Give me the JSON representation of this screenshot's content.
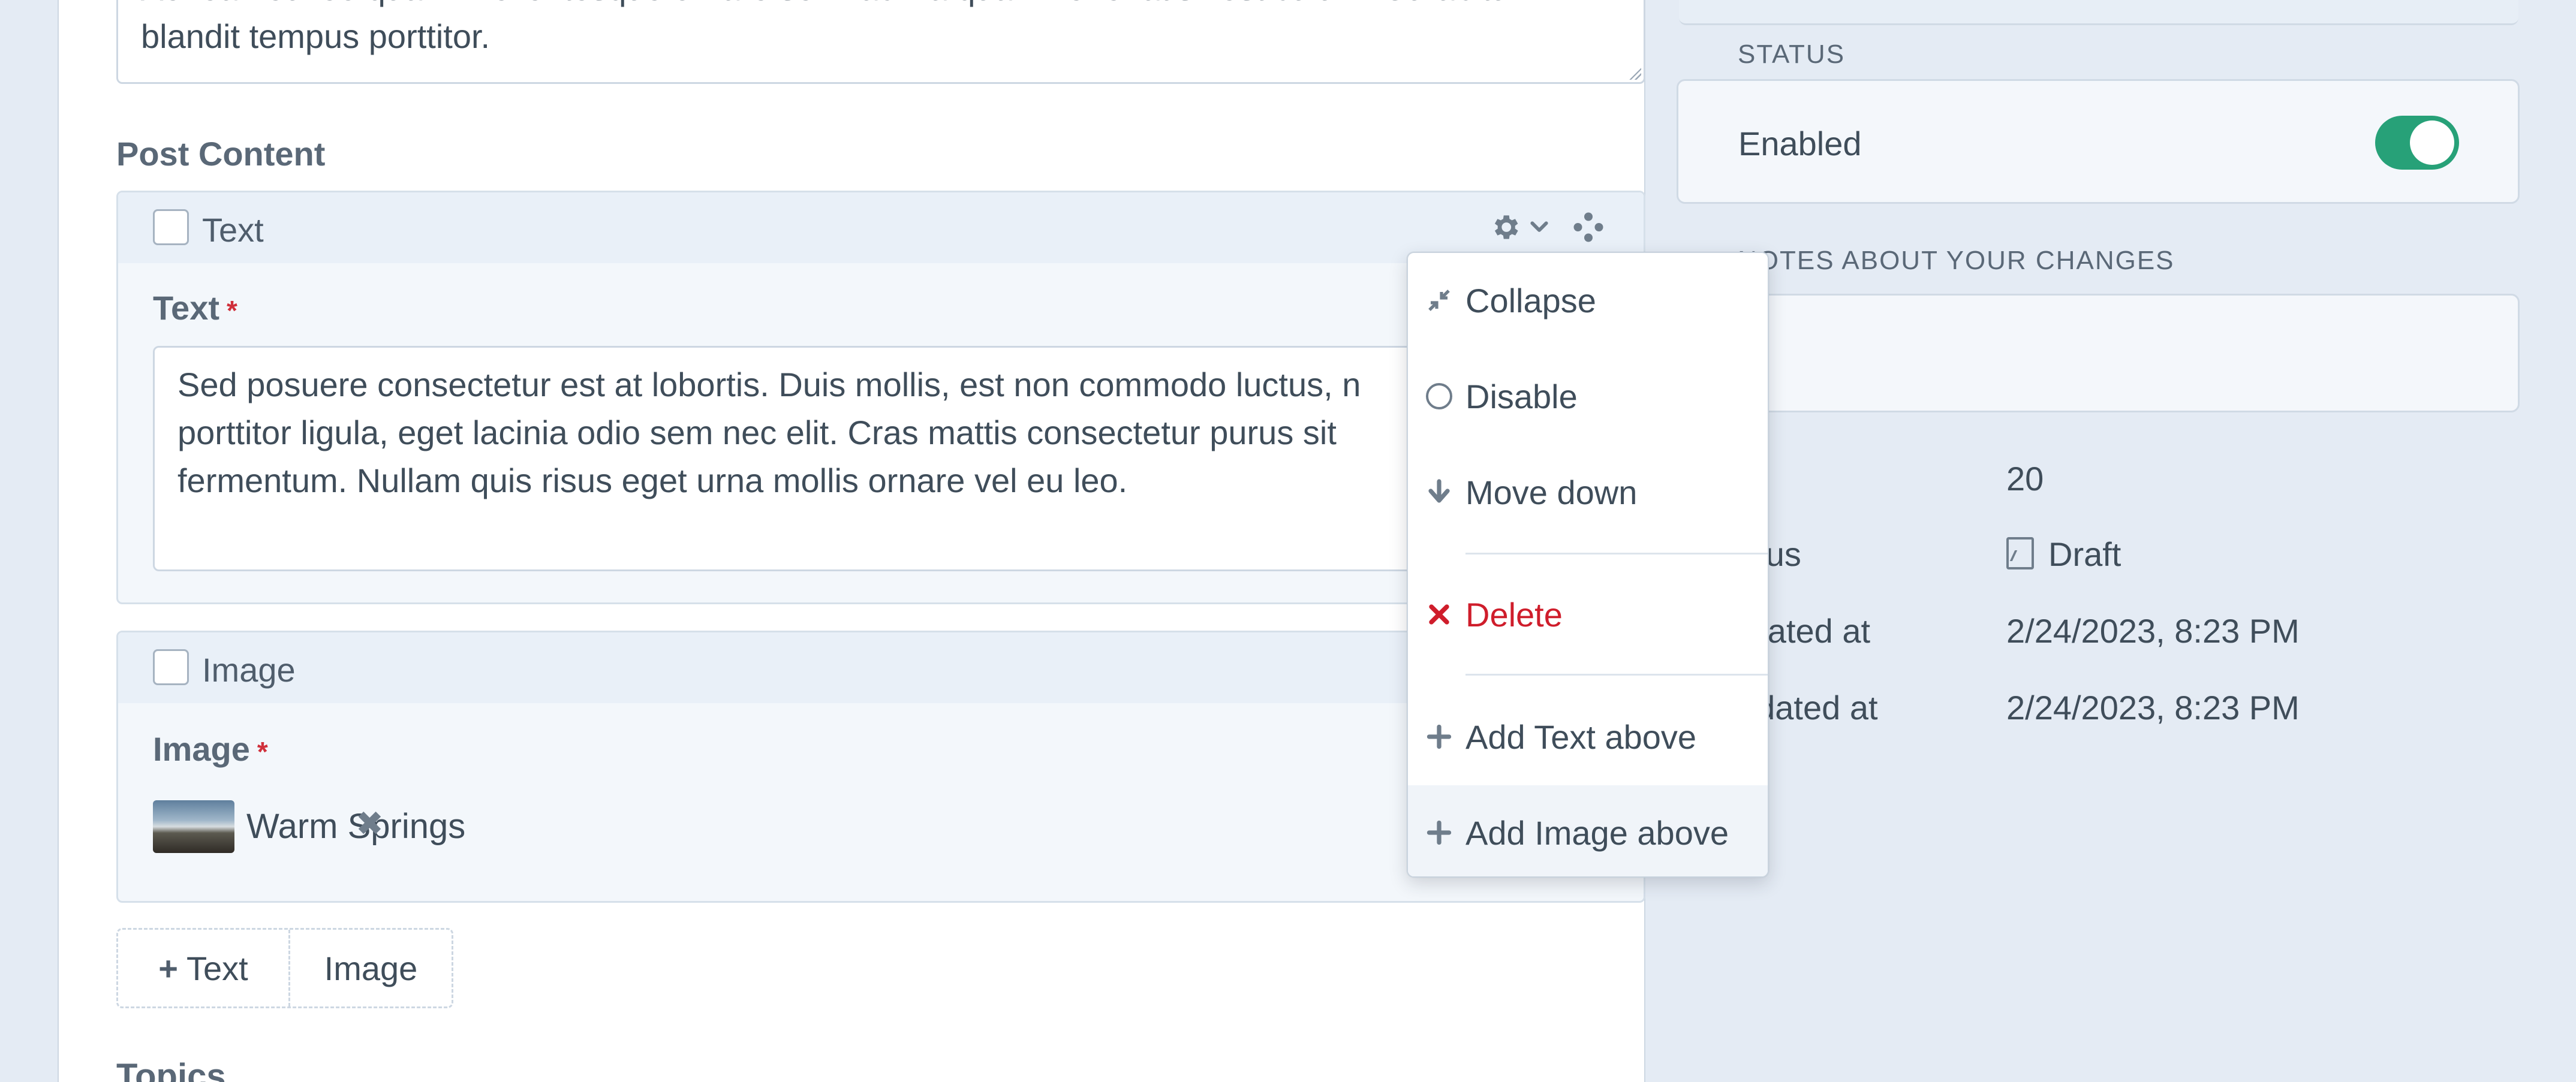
{
  "excerpt": {
    "line1": "Aenean eu leo quam. Pellentesque ornare sem lacinia quam venenatis vestibulum. Curabitur",
    "line2": "blandit tempus porttitor."
  },
  "post_content": {
    "label": "Post Content",
    "text_block": {
      "title": "Text",
      "field_label": "Text",
      "required_mark": "*",
      "lines": [
        "Sed posuere consectetur est at lobortis. Duis mollis, est non commodo luctus, n",
        "porttitor ligula, eget lacinia odio sem nec elit. Cras mattis consectetur purus sit",
        "fermentum. Nullam quis risus eget urna mollis ornare vel eu leo."
      ]
    },
    "image_block": {
      "title": "Image",
      "field_label": "Image",
      "required_mark": "*",
      "asset_name": "Warm Springs",
      "remove_glyph": "✖"
    },
    "add_buttons": {
      "text": "Text",
      "image": "Image",
      "plus": "+"
    }
  },
  "topics": {
    "label": "Topics"
  },
  "sidebar": {
    "status_heading": "STATUS",
    "status_label": "Enabled",
    "status_enabled": true,
    "notes_heading": "NOTES ABOUT YOUR CHANGES",
    "meta": [
      {
        "label": "",
        "value": "20"
      },
      {
        "label": "atus",
        "value": "Draft"
      },
      {
        "label": "reated at",
        "value": "2/24/2023, 8:23 PM"
      },
      {
        "label": "odated at",
        "value": "2/24/2023, 8:23 PM"
      }
    ]
  },
  "menu": {
    "items": [
      {
        "label": "Collapse",
        "icon": "collapse-icon"
      },
      {
        "label": "Disable",
        "icon": "circle-icon"
      },
      {
        "label": "Move down",
        "icon": "arrow-down-icon"
      },
      {
        "label": "Delete",
        "icon": "x-icon"
      },
      {
        "label": "Add Text above",
        "icon": "plus-icon"
      },
      {
        "label": "Add Image above",
        "icon": "plus-icon"
      }
    ]
  },
  "colors": {
    "accent_green": "#27a178",
    "danger_red": "#cf1d2b",
    "page_bg": "#e4ebf4"
  }
}
